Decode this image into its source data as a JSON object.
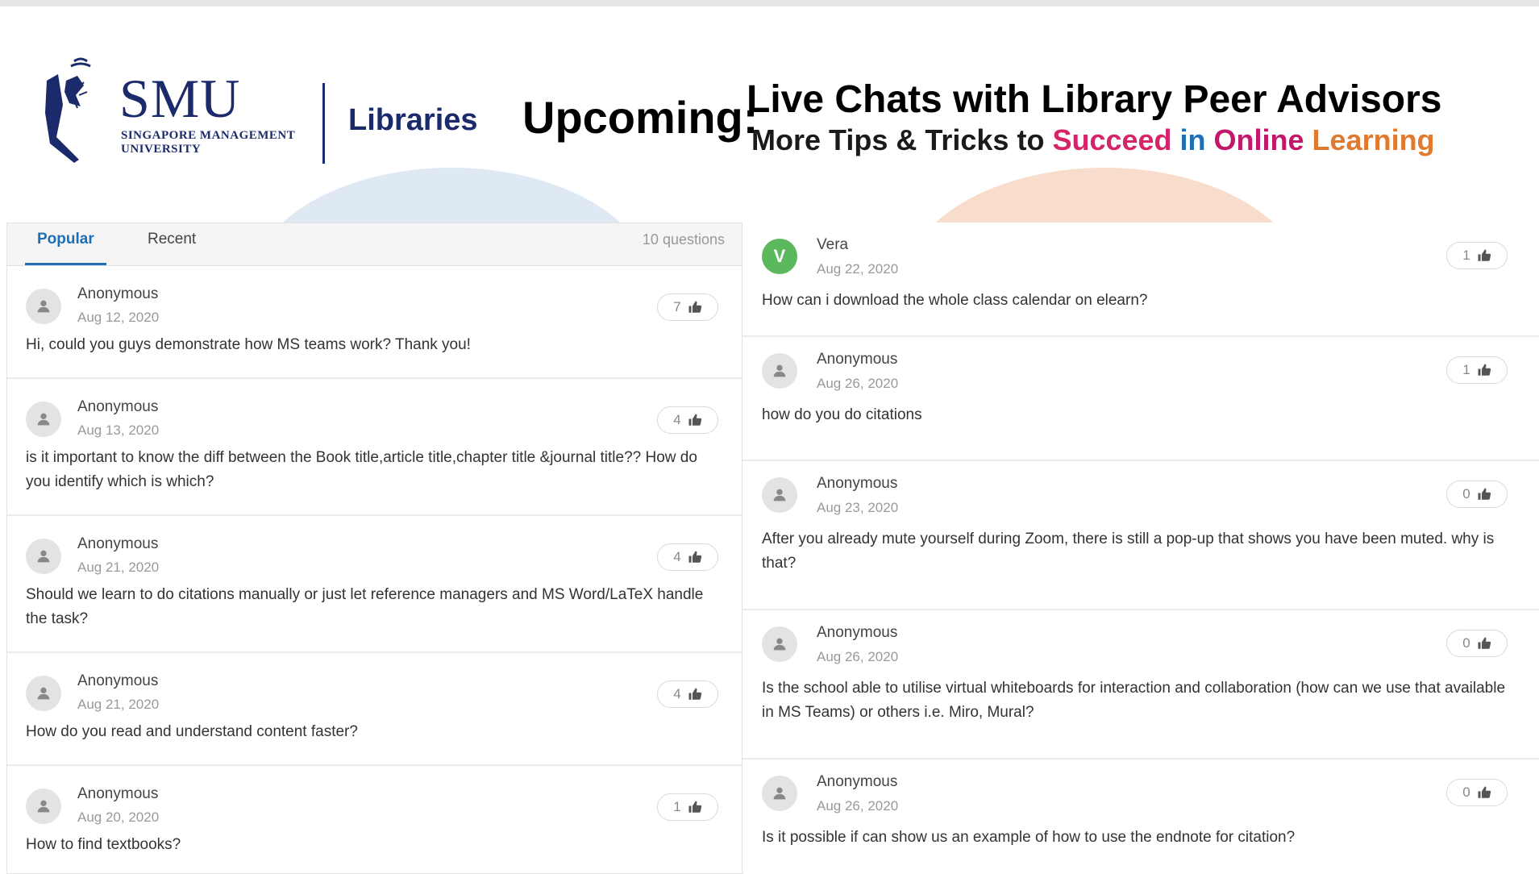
{
  "banner": {
    "smu": "SMU",
    "smu_sub": "Singapore Management University",
    "libraries": "Libraries",
    "upcoming": "Upcoming:",
    "headline": "Live Chats with Library Peer Advisors",
    "tips_prefix": "More Tips & Tricks to ",
    "tips_words": [
      {
        "text": "Succeed",
        "color": "#d6246b"
      },
      {
        "text": " in ",
        "color": "#1f6fb5"
      },
      {
        "text": "Online",
        "color": "#c2186b"
      },
      {
        "text": " Learning",
        "color": "#e07a2f"
      }
    ]
  },
  "tabs": {
    "popular": "Popular",
    "recent": "Recent",
    "count": "10 questions"
  },
  "left_questions": [
    {
      "author": "Anonymous",
      "date": "Aug 12, 2020",
      "votes": "7",
      "text": "Hi, could you guys demonstrate how MS teams work? Thank you!"
    },
    {
      "author": "Anonymous",
      "date": "Aug 13, 2020",
      "votes": "4",
      "text": "is it important to know the diff between the Book title,article title,chapter title &journal title?? How do you identify which is which?"
    },
    {
      "author": "Anonymous",
      "date": "Aug 21, 2020",
      "votes": "4",
      "text": "Should we learn to do citations manually or just let reference managers and MS Word/LaTeX handle the task?"
    },
    {
      "author": "Anonymous",
      "date": "Aug 21, 2020",
      "votes": "4",
      "text": "How do you read and understand content faster?"
    },
    {
      "author": "Anonymous",
      "date": "Aug 20, 2020",
      "votes": "1",
      "text": "How to find textbooks?"
    }
  ],
  "right_questions": [
    {
      "author": "Vera",
      "initial": "V",
      "date": "Aug 22, 2020",
      "votes": "1",
      "text": "How can i download the whole class calendar on elearn?"
    },
    {
      "author": "Anonymous",
      "date": "Aug 26, 2020",
      "votes": "1",
      "text": "how do you do citations"
    },
    {
      "author": "Anonymous",
      "date": "Aug 23, 2020",
      "votes": "0",
      "text": "After you already mute yourself during Zoom, there is still a pop-up that shows you have been muted. why is that?"
    },
    {
      "author": "Anonymous",
      "date": "Aug 26, 2020",
      "votes": "0",
      "text": "Is the school able to utilise virtual whiteboards for interaction and collaboration (how can we use that available in MS Teams) or others i.e. Miro, Mural?"
    },
    {
      "author": "Anonymous",
      "date": "Aug 26, 2020",
      "votes": "0",
      "text": "Is it possible if can show us an example of how to use the endnote for citation?"
    }
  ]
}
